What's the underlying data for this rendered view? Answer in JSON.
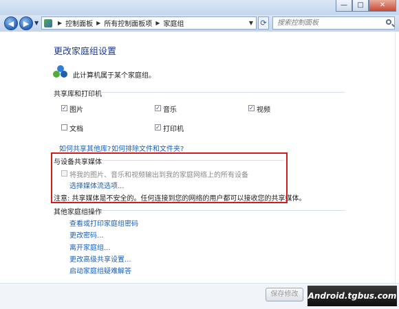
{
  "window": {
    "controls": {
      "minimize": "—",
      "maximize": "□",
      "close": "✕"
    }
  },
  "nav": {
    "back_icon": "back-arrow-icon",
    "forward_icon": "forward-arrow-icon",
    "breadcrumbs": [
      "控制面板",
      "所有控制面板项",
      "家庭组"
    ],
    "search_placeholder": "搜索控制面板"
  },
  "main": {
    "title": "更改家庭组设置",
    "membership_text": "此计算机属于某个家庭组。",
    "share_section_title": "共享库和打印机",
    "share_items": [
      {
        "label": "图片",
        "checked": true
      },
      {
        "label": "音乐",
        "checked": true
      },
      {
        "label": "视频",
        "checked": true
      },
      {
        "label": "文档",
        "checked": false
      },
      {
        "label": "打印机",
        "checked": true
      }
    ],
    "links_row": [
      "如何共享其他库?",
      "如何排除文件和文件夹?"
    ],
    "media_section_title": "与设备共享媒体",
    "media_checkbox_label": "将我的图片、音乐和视频输出到我的家庭网络上的所有设备",
    "media_link": "选择媒体流选项...",
    "media_warning": "注意: 共享媒体是不安全的。任何连接到您的网络的用户都可以接收您的共享媒体。",
    "other_section_title": "其他家庭组操作",
    "other_actions": [
      "查看或打印家庭组密码",
      "更改密码...",
      "离开家庭组...",
      "更改高级共享设置...",
      "启动家庭组疑难解答"
    ]
  },
  "footer": {
    "save_label": "保存修改",
    "cancel_label": "取消",
    "watermark": "Android.tgbus.com"
  },
  "colors": {
    "link": "#1a5fb4",
    "highlight_border": "#d51a1a",
    "title": "#1e3a8a"
  }
}
